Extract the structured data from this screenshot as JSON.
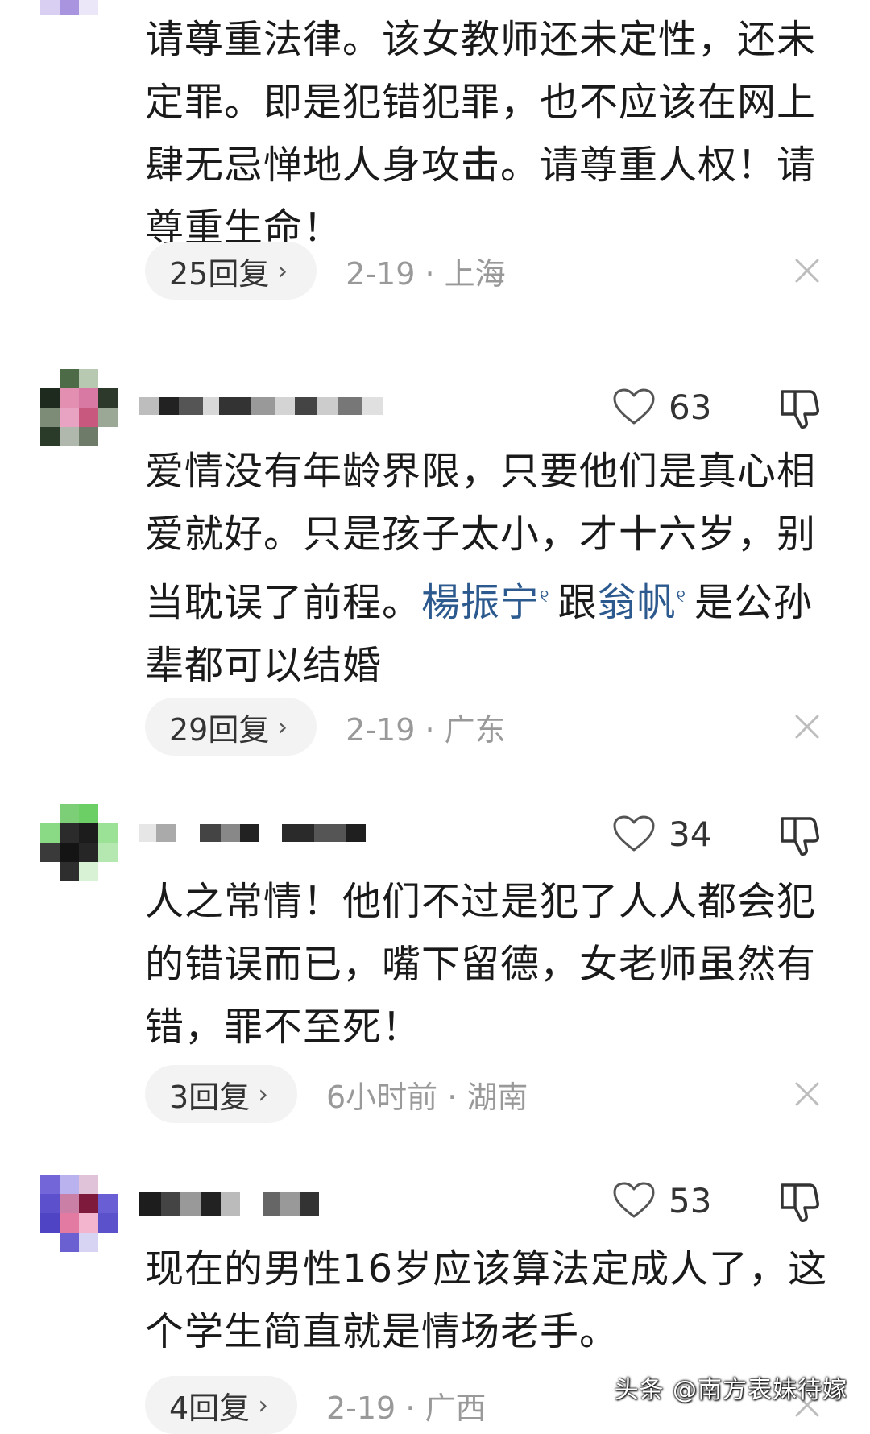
{
  "comments": [
    {
      "partial": true,
      "text": "请尊重法律。该女教师还未定性，还未定罪。即是犯错犯罪，也不应该在网上肆无忌惮地人身攻击。请尊重人权！请尊重生命！",
      "reply_label": "25回复",
      "date_location": "2-19 · 上海"
    },
    {
      "likes": "63",
      "text_before": "爱情没有年龄界限，只要他们是真心相爱就好。只是孩子太小，才十六岁，别当耽误了前程。",
      "tag1": "楊振宁",
      "text_mid": "跟",
      "tag2": "翁帆",
      "text_after": "是公孙辈都可以结婚",
      "reply_label": "29回复",
      "date_location": "2-19 · 广东"
    },
    {
      "likes": "34",
      "text": "人之常情！他们不过是犯了人人都会犯的错误而已，嘴下留德，女老师虽然有错，罪不至死！",
      "reply_label": "3回复",
      "date_location": "6小时前 · 湖南"
    },
    {
      "likes": "53",
      "text": "现在的男性16岁应该算法定成人了，这个学生简直就是情场老手。",
      "reply_label": "4回复",
      "date_location": "2-19 · 广西"
    }
  ],
  "icons": {
    "like": "heart-outline-icon",
    "dislike": "thumbs-down-outline-icon",
    "reply_chevron": "chevron-right-icon",
    "close": "close-x-icon",
    "tag_search": "search-icon"
  },
  "colors": {
    "text": "#1a1a1a",
    "meta": "#999999",
    "tag_link": "#2c5a8e",
    "pill_bg": "#f3f3f3",
    "icon_muted": "#bbbbbb"
  },
  "watermark": "头条 @南方表妹待嫁"
}
